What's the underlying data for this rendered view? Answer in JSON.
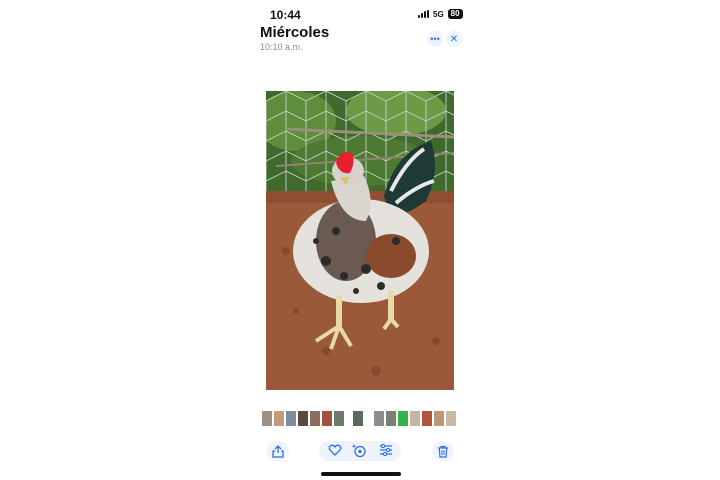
{
  "status_bar": {
    "time": "10:44",
    "network": "5G",
    "battery": "80"
  },
  "header": {
    "title": "Miércoles",
    "subtitle": "10:10 a.m."
  },
  "header_buttons": {
    "more_icon": "ellipsis-icon",
    "close_icon": "close-icon"
  },
  "photo": {
    "subject": ""
  },
  "thumbnails": {
    "count": 16,
    "colors": [
      "#9d8f86",
      "#c49a79",
      "#7c8da0",
      "#5a4a3f",
      "#8a6d5c",
      "#a0523c",
      "#6d7b6b",
      "#5b6a5c",
      "#8e8d8b",
      "#7e7f74",
      "#35b24a",
      "#c6b5a0",
      "#b5523e",
      "#b89977",
      "#c7bba8",
      "#4d4a44"
    ]
  },
  "toolbar": {
    "share_icon": "share-icon",
    "favorite_icon": "heart-icon",
    "visual_lookup_icon": "visual-lookup-icon",
    "adjust_icon": "sliders-icon",
    "delete_icon": "trash-icon"
  },
  "colors": {
    "accent": "#2f6ee8",
    "button_bg": "#eef3fd"
  }
}
